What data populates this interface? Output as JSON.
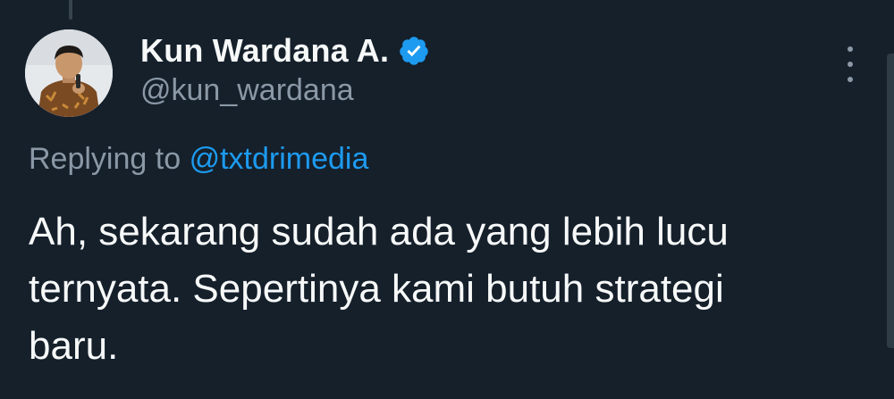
{
  "tweet": {
    "author": {
      "display_name": "Kun Wardana A.",
      "handle": "@kun_wardana",
      "verified": true,
      "verified_icon": "verified-badge-icon",
      "avatar": "profile-photo"
    },
    "reply_prefix": "Replying to",
    "reply_to": "@txtdrimedia",
    "text": "Ah, sekarang sudah ada yang lebih lucu\nternyata. Sepertinya kami butuh strategi\nbaru.",
    "more_icon": "vertical-ellipsis-icon"
  },
  "colors": {
    "background": "#15202b",
    "primary_text": "#f7f9f9",
    "secondary_text": "#8b98a5",
    "accent": "#1d9bf0"
  }
}
